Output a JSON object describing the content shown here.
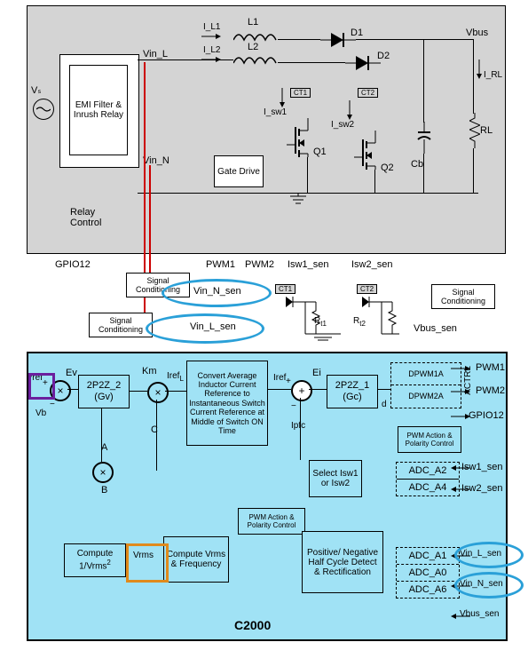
{
  "power": {
    "source": "Vₛ",
    "emi": "EMI Filter & Inrush Relay",
    "vin_l": "Vin_L",
    "vin_n": "Vin_N",
    "relay": "Relay Control",
    "gate": "Gate Drive",
    "L1": "L1",
    "L2": "L2",
    "iL1": "I_L1",
    "iL2": "I_L2",
    "D1": "D1",
    "D2": "D2",
    "Q1": "Q1",
    "Q2": "Q2",
    "isw1": "I_sw1",
    "isw2": "I_sw2",
    "ct1": "CT1",
    "ct2": "CT2",
    "Cb": "Cb",
    "RL": "RL",
    "Vbus": "Vbus",
    "IRL": "I_RL"
  },
  "bridge": {
    "gpio12": "GPIO12",
    "pwm1": "PWM1",
    "pwm2": "PWM2",
    "isw1s": "Isw1_sen",
    "isw2s": "Isw2_sen",
    "sc": "Signal Conditioning",
    "vin_n_sen": "Vin_N_sen",
    "vin_l_sen": "Vin_L_sen",
    "r_t1": "R_t1",
    "r_t2": "R_t2",
    "vbus_sen": "Vbus_sen",
    "ct1": "CT1",
    "ct2": "CT2"
  },
  "ctrl": {
    "title": "C2000",
    "vref": "Vref",
    "vb": "Vb",
    "ev": "Ev",
    "gv": {
      "top": "2P2Z_2",
      "bot": "(Gv)"
    },
    "km": "Km",
    "irefL": "IrefL",
    "A": "A",
    "B": "B",
    "C": "C",
    "conv": "Convert Average Inductor Current Reference to Instantaneous Switch Current Reference at Middle of Switch ON Time",
    "iref": "Iref",
    "ei": "Ei",
    "ipfc": "Ipfc",
    "gc": {
      "top": "2P2Z_1",
      "bot": "(Gc)"
    },
    "d": "d",
    "dpwm1": "DPWM1A",
    "dpwm2": "DPWM2A",
    "actrl": "ACTRL",
    "pwmPol": "PWM Action & Polarity Control",
    "select": "Select Isw1 or Isw2",
    "adcA2": "ADC_A2",
    "adcA4": "ADC_A4",
    "comp1": "Compute 1/Vrms²",
    "vrms": "Vrms",
    "comp2": "Compute Vrms & Frequency",
    "rect": "Positive/ Negative Half Cycle Detect & Rectification",
    "pwmPol2": "PWM Action & Polarity Control",
    "adcA1": "ADC_A1",
    "adcA0": "ADC_A0",
    "adcA6": "ADC_A6"
  },
  "outR": {
    "pwm1": "PWM1",
    "pwm2": "PWM2",
    "gpio12": "GPIO12",
    "isw1": "Isw1_sen",
    "isw2": "Isw2_sen",
    "vinL": "Vin_L_sen",
    "vinN": "Vin_N_sen",
    "vbus": "Vbus_sen"
  }
}
